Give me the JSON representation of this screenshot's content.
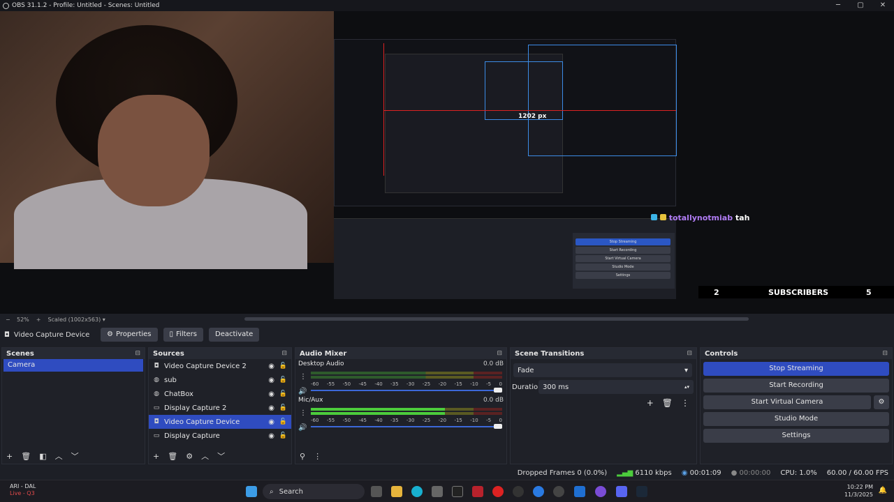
{
  "window": {
    "title": "OBS 31.1.2 - Profile: Untitled - Scenes: Untitled",
    "min": "─",
    "max": "▢",
    "close": "✕"
  },
  "preview": {
    "px_label": "1202 px",
    "chat_user": "totallynotmiab",
    "chat_msg": "tah",
    "subs_left": "2",
    "subs_label": "SUBSCRIBERS",
    "subs_right": "5"
  },
  "zoom": {
    "level": "52%",
    "plus": "+",
    "minus": "−",
    "mode": "Scaled (1002x563)"
  },
  "source_toolbar": {
    "name": "Video Capture Device",
    "properties": "Properties",
    "filters": "Filters",
    "deactivate": "Deactivate"
  },
  "scenes": {
    "title": "Scenes",
    "items": [
      "Camera"
    ]
  },
  "sources": {
    "title": "Sources",
    "items": [
      "Video Capture Device 2",
      "sub",
      "ChatBox",
      "Display Capture 2",
      "Video Capture Device",
      "Display Capture"
    ]
  },
  "audio": {
    "title": "Audio Mixer",
    "channels": [
      {
        "name": "Desktop Audio",
        "db": "0.0 dB",
        "level": 0
      },
      {
        "name": "Mic/Aux",
        "db": "0.0 dB",
        "level": 0.7
      }
    ],
    "ticks": [
      "-60",
      "-55",
      "-50",
      "-45",
      "-40",
      "-35",
      "-30",
      "-25",
      "-20",
      "-15",
      "-10",
      "-5",
      "0"
    ]
  },
  "transitions": {
    "title": "Scene Transitions",
    "type": "Fade",
    "duration_label": "Duration",
    "duration": "300 ms"
  },
  "controls": {
    "title": "Controls",
    "stop_streaming": "Stop Streaming",
    "start_recording": "Start Recording",
    "start_virtual_camera": "Start Virtual Camera",
    "studio_mode": "Studio Mode",
    "settings": "Settings"
  },
  "status": {
    "dropped": "Dropped Frames 0 (0.0%)",
    "bitrate": "6110 kbps",
    "stream_time": "00:01:09",
    "rec_time": "00:00:00",
    "cpu": "CPU: 1.0%",
    "fps": "60.00 / 60.00 FPS"
  },
  "taskbar": {
    "stream_name": "ARI - DAL",
    "stream_status": "Live - Q3",
    "search": "Search",
    "time": "10:22 PM",
    "date": "11/3/2025"
  },
  "colors": {
    "accent": "#2f4cc0",
    "meter_green": "#4ccc3c",
    "live_red": "#e24b4b"
  }
}
